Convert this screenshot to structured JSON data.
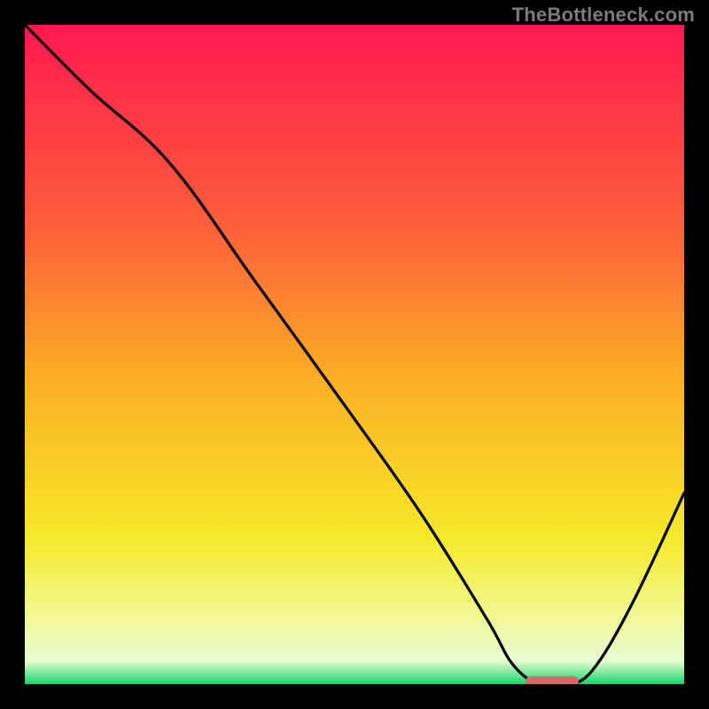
{
  "watermark": "TheBottleneck.com",
  "colors": {
    "background": "#000000",
    "watermark_text": "#7b7b7b",
    "curve": "#000000",
    "marker": "#d66a6a",
    "gradient_stops": [
      {
        "offset": 0.0,
        "color": "#ff1850"
      },
      {
        "offset": 0.3,
        "color": "#fe5d3b"
      },
      {
        "offset": 0.55,
        "color": "#fbb224"
      },
      {
        "offset": 0.78,
        "color": "#f6e92a"
      },
      {
        "offset": 0.9,
        "color": "#f1f896"
      },
      {
        "offset": 0.965,
        "color": "#e8fbd0"
      },
      {
        "offset": 1.0,
        "color": "#12d66b"
      }
    ]
  },
  "chart_data": {
    "type": "line",
    "title": "",
    "xlabel": "",
    "ylabel": "",
    "xlim": [
      0,
      100
    ],
    "ylim": [
      0,
      100
    ],
    "x": [
      0,
      10,
      22,
      35,
      48,
      60,
      70,
      74,
      78,
      82,
      86,
      92,
      100
    ],
    "values": [
      100,
      90,
      79,
      61,
      43,
      26,
      10,
      3,
      0,
      0,
      2,
      12,
      29
    ],
    "marker": {
      "x_start": 76,
      "x_end": 84,
      "y": 0.5
    }
  }
}
